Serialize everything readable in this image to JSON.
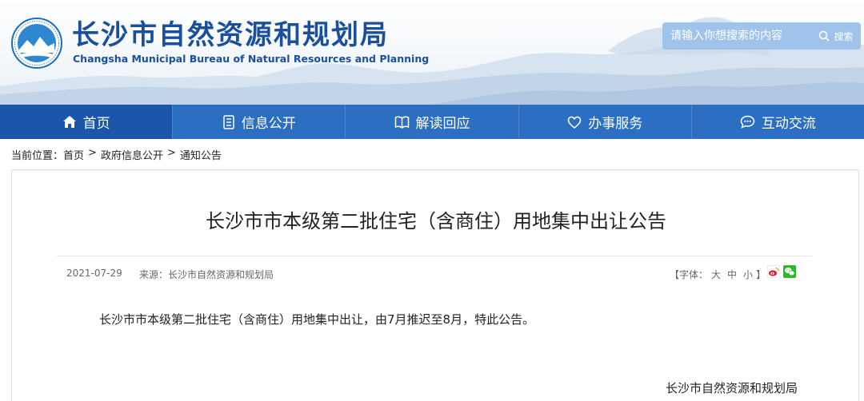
{
  "header": {
    "title_cn": "长沙市自然资源和规划局",
    "title_en": "Changsha Municipal Bureau of Natural Resources and Planning",
    "brand_color": "#1a4f9c"
  },
  "search": {
    "placeholder": "请输入你想搜索的内容",
    "button_label": "搜索",
    "icon": "search-icon"
  },
  "nav": {
    "items": [
      {
        "label": "首页",
        "icon": "home-icon",
        "active": true
      },
      {
        "label": "信息公开",
        "icon": "document-list-icon"
      },
      {
        "label": "解读回应",
        "icon": "book-icon"
      },
      {
        "label": "办事服务",
        "icon": "heart-icon"
      },
      {
        "label": "互动交流",
        "icon": "chat-icon"
      }
    ],
    "bg_color": "#2c6fc2",
    "active_color": "#1b56a8"
  },
  "breadcrumb": {
    "prefix": "当前位置：",
    "items": [
      "首页",
      "政府信息公开",
      "通知公告"
    ],
    "separator": ">"
  },
  "article": {
    "title": "长沙市市本级第二批住宅（含商住）用地集中出让公告",
    "date": "2021-07-29",
    "source_label": "来源：",
    "source": "长沙市自然资源和规划局",
    "font_size_label_open": "【字体：",
    "font_size_options": [
      "大",
      "中",
      "小"
    ],
    "font_size_label_close": "】",
    "share_icons": [
      "weibo-icon",
      "wechat-icon"
    ],
    "body": "长沙市市本级第二批住宅（含商住）用地集中出让，由7月推迟至8月，特此公告。",
    "signature": "长沙市自然资源和规划局"
  }
}
